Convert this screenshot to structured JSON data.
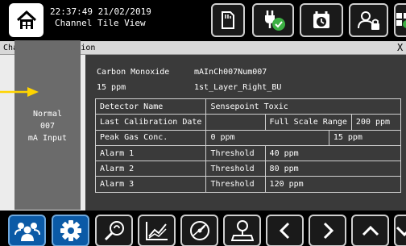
{
  "header": {
    "time": "22:37:49",
    "date": "21/02/2019",
    "view_title": "Channel Tile View",
    "icons": [
      "home-icon",
      "sim-card-icon",
      "power-check-icon",
      "schedule-icon",
      "user-lock-icon",
      "grid-menu-icon"
    ]
  },
  "panel": {
    "title": "Channel Information",
    "close_label": "X"
  },
  "tile": {
    "status": "Normal",
    "channel_number": "007",
    "input_type": "mA Input"
  },
  "channel": {
    "gas_name": "Carbon Monoxide",
    "tag": "mAInCh007Num007",
    "reading": "15 ppm",
    "location": "1st_Layer_Right_BU"
  },
  "details": {
    "detector_name_label": "Detector Name",
    "detector_name": "Sensepoint Toxic",
    "last_calibration_label": "Last Calibration Date",
    "last_calibration": "",
    "full_scale_label": "Full Scale Range",
    "full_scale": "200 ppm",
    "peak_gas_label": "Peak Gas Conc.",
    "peak_gas": "0 ppm",
    "peak_gas_2": "15 ppm",
    "alarms": [
      {
        "label": "Alarm 1",
        "type": "Threshold",
        "value": "40 ppm"
      },
      {
        "label": "Alarm 2",
        "type": "Threshold",
        "value": "80 ppm"
      },
      {
        "label": "Alarm 3",
        "type": "Threshold",
        "value": "120 ppm"
      }
    ]
  },
  "footer": {
    "icons": [
      "user-group-icon",
      "gear-icon",
      "service-icon",
      "trend-chart-icon",
      "gauge-icon",
      "location-user-icon",
      "chevron-left-icon",
      "chevron-right-icon",
      "chevron-up-icon",
      "chevron-down-icon"
    ]
  },
  "colors": {
    "accent_yellow": "#ffd400",
    "active_blue": "#0b5aa6",
    "status_green": "#3cb043"
  }
}
